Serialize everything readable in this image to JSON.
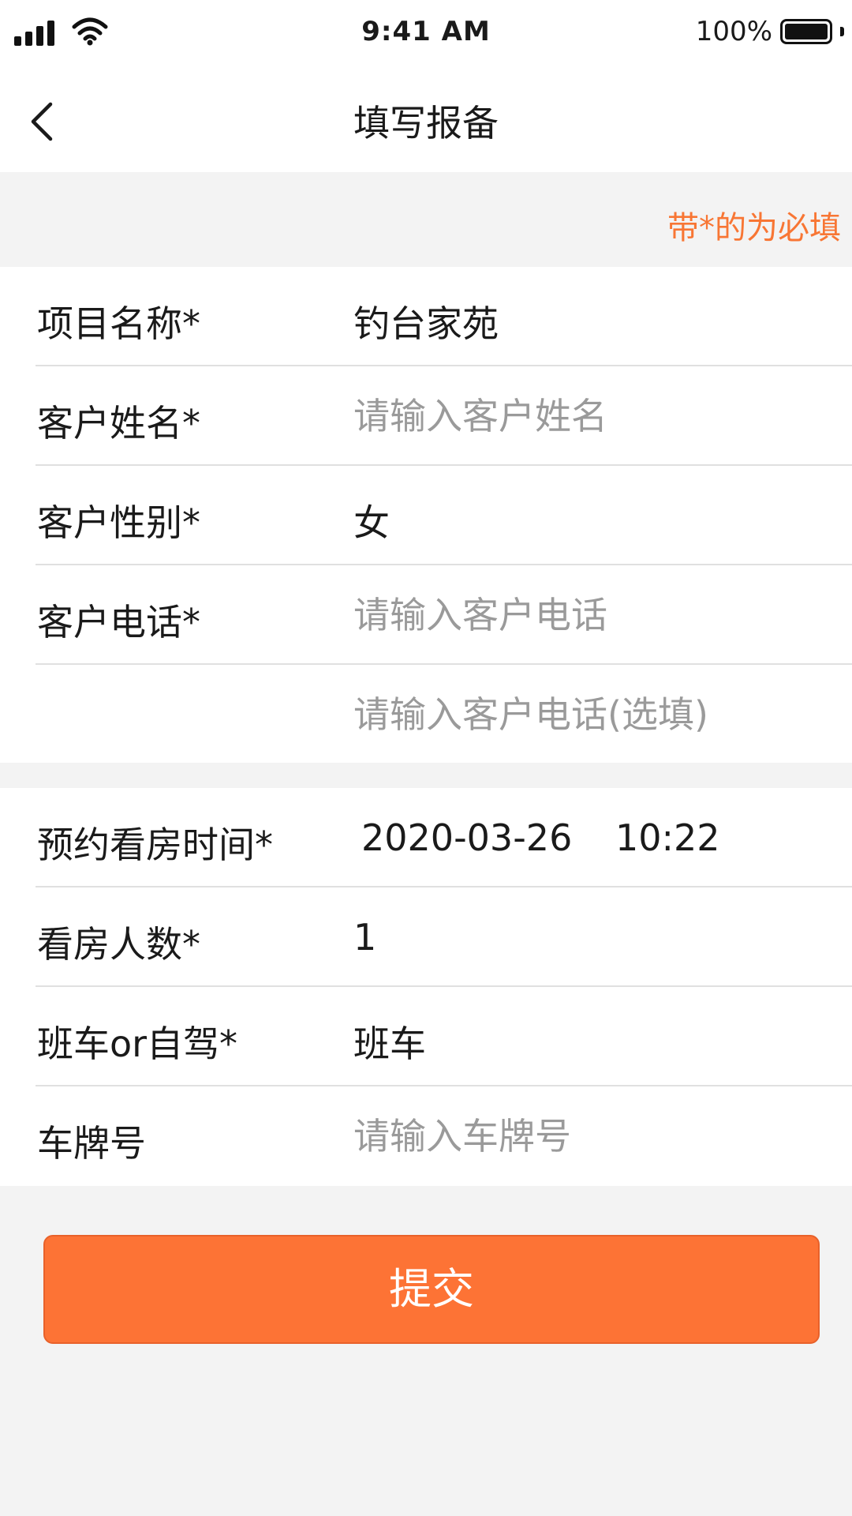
{
  "status_bar": {
    "time": "9:41 AM",
    "battery_percent": "100%",
    "battery_level": 1.0
  },
  "nav": {
    "title": "填写报备",
    "back_icon": "chevron-left-icon"
  },
  "required_hint": "带*的为必填",
  "form": {
    "project_name": {
      "label": "项目名称*",
      "value": "钓台家苑"
    },
    "customer_name": {
      "label": "客户姓名*",
      "placeholder": "请输入客户姓名"
    },
    "customer_gender": {
      "label": "客户性别*",
      "value": "女"
    },
    "customer_phone": {
      "label": "客户电话*",
      "placeholder": "请输入客户电话"
    },
    "customer_phone_optional": {
      "placeholder": "请输入客户电话(选填)"
    },
    "visit_time": {
      "label": "预约看房时间*",
      "date": "2020-03-26",
      "time": "10:22"
    },
    "visitor_count": {
      "label": "看房人数*",
      "value": "1"
    },
    "transport": {
      "label": "班车or自驾*",
      "value": "班车"
    },
    "plate_number": {
      "label": "车牌号",
      "placeholder": "请输入车牌号"
    }
  },
  "submit_label": "提交",
  "colors": {
    "accent": "#fd7335",
    "hint": "#f87634",
    "background": "#f3f3f3",
    "placeholder": "#9a9a9a"
  }
}
